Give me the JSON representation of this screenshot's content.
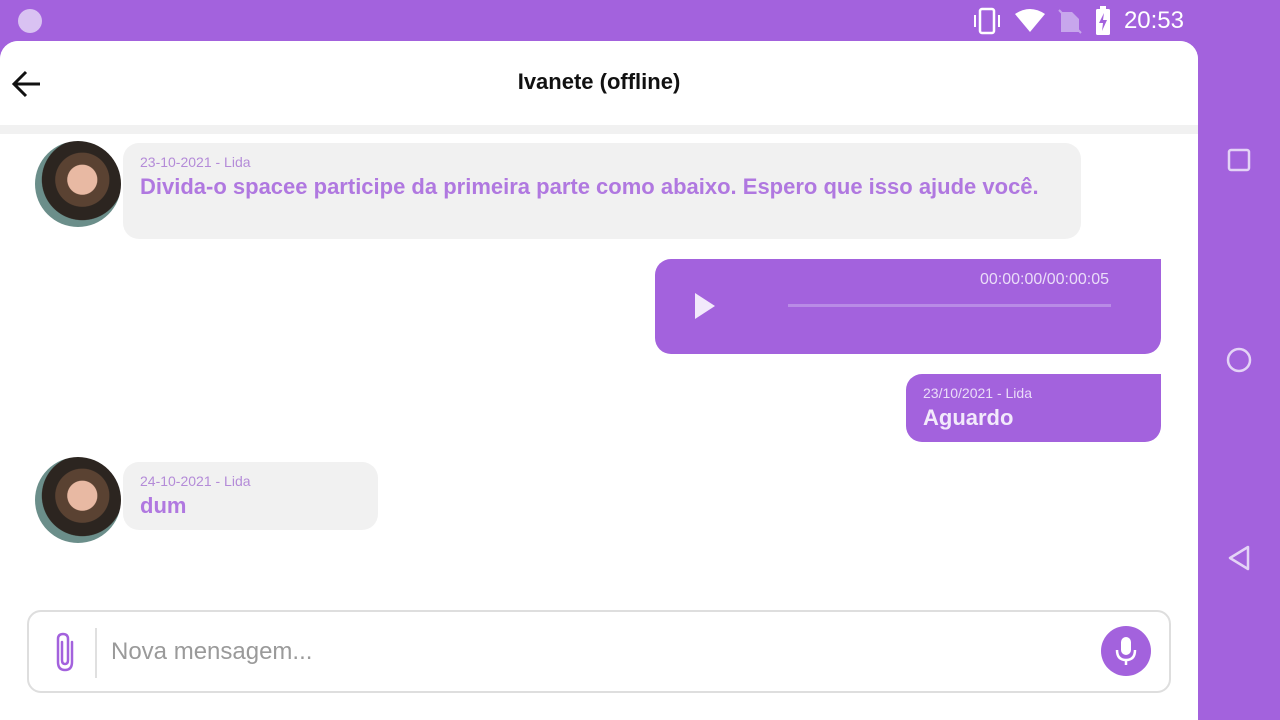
{
  "status_bar": {
    "time": "20:53",
    "icons": [
      "vibrate-icon",
      "wifi-icon",
      "no-sim-icon",
      "battery-charging-icon"
    ]
  },
  "header": {
    "title": "Ivanete (offline)"
  },
  "messages": [
    {
      "direction": "incoming",
      "meta": "23-10-2021 - Lida",
      "text": "Divida-o spacee participe da primeira parte como abaixo. Espero que isso ajude você."
    },
    {
      "direction": "outgoing",
      "type": "audio",
      "duration": "00:00:00/00:00:05",
      "progress": 0
    },
    {
      "direction": "outgoing",
      "meta": "23/10/2021 - Lida",
      "text": "Aguardo"
    },
    {
      "direction": "incoming",
      "meta": "24-10-2021 - Lida",
      "text": "dum"
    }
  ],
  "composer": {
    "placeholder": "Nova mensagem..."
  },
  "colors": {
    "accent": "#a362dd",
    "incoming_bubble": "#f1f1f1",
    "incoming_text": "#b078e0"
  }
}
